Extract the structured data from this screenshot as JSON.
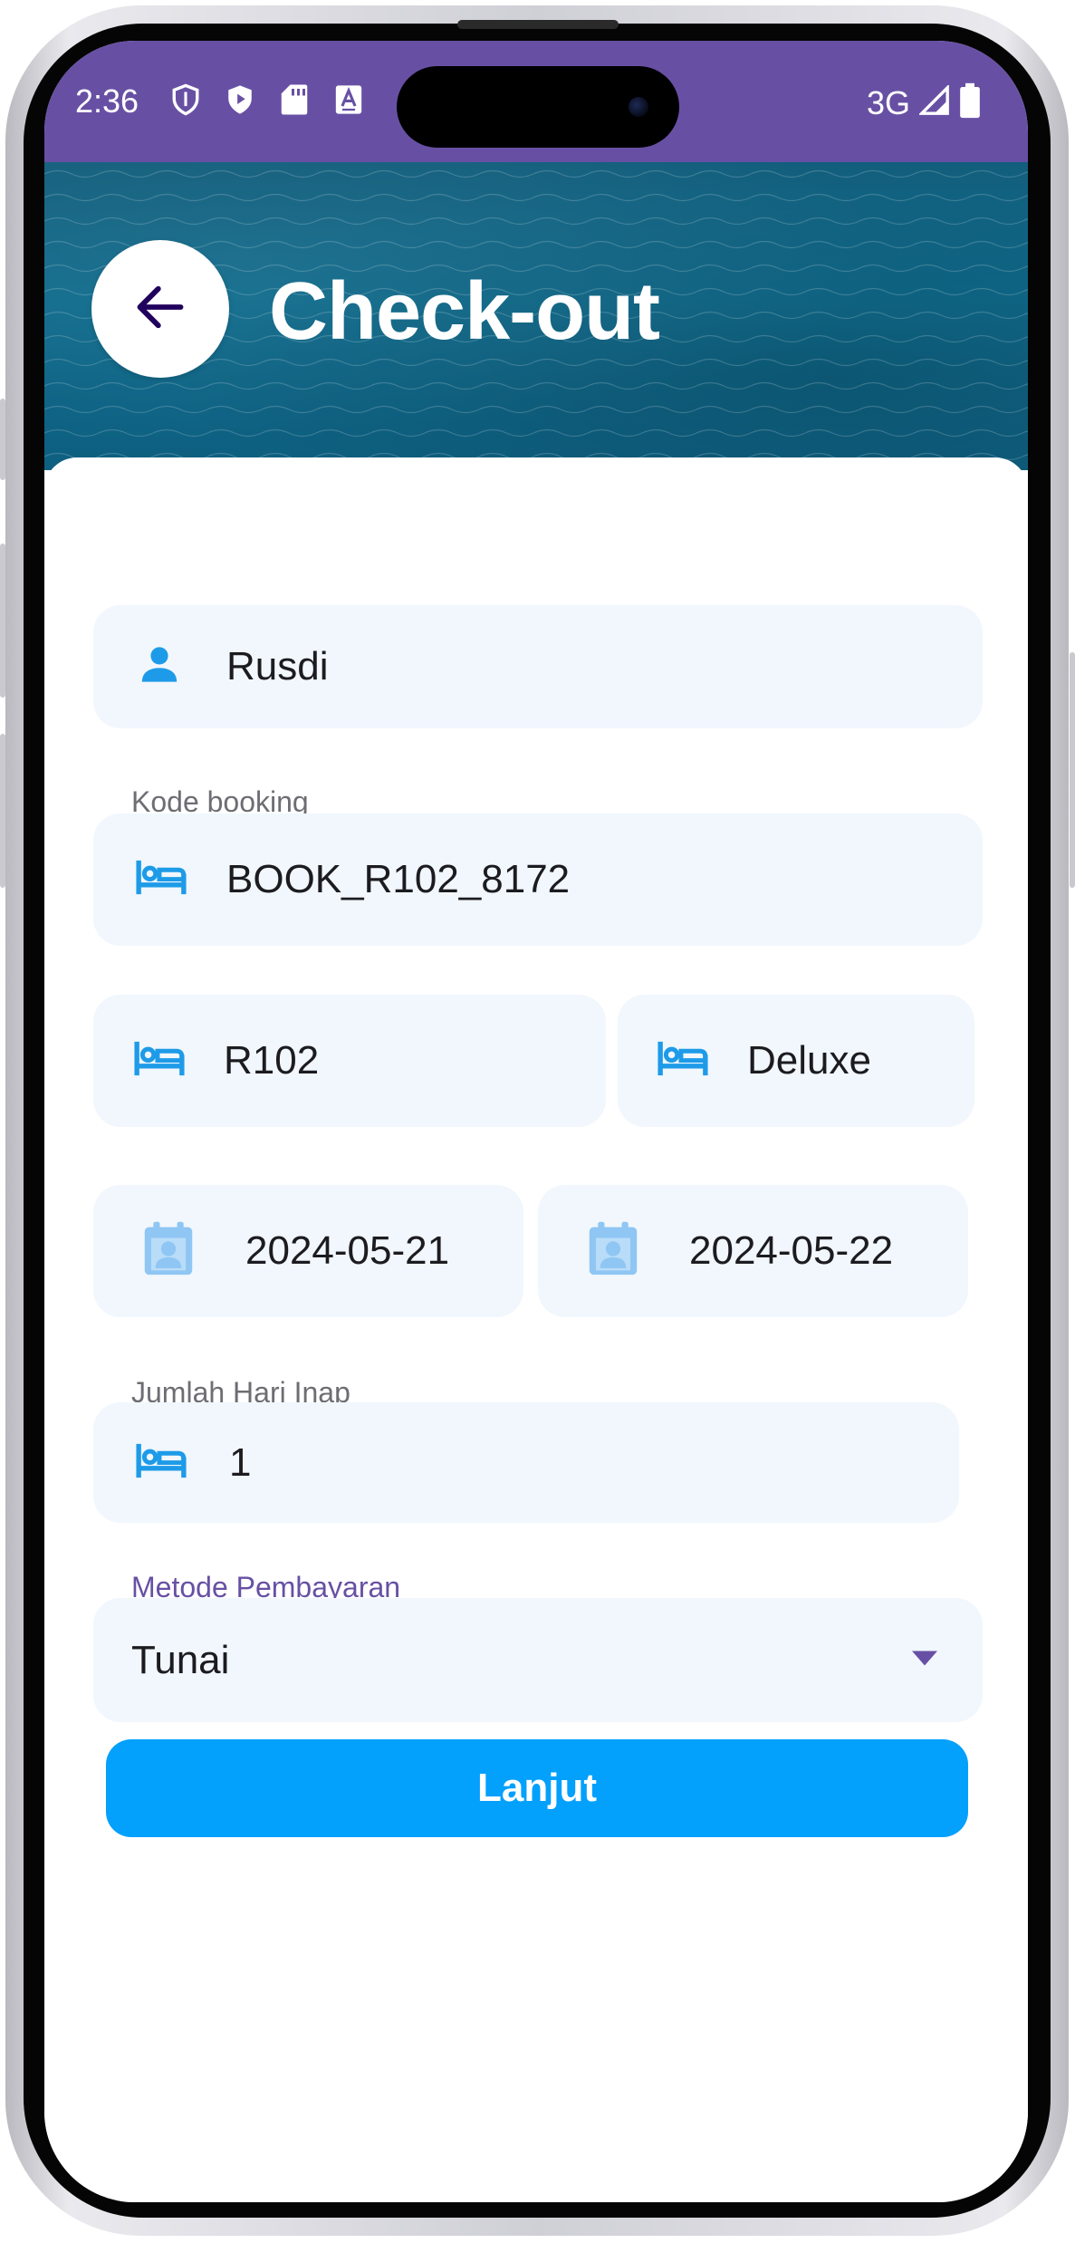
{
  "status_bar": {
    "time": "2:36",
    "network": "3G",
    "icons": [
      "shield-outline-icon",
      "shield-play-icon",
      "sd-card-icon",
      "font-a-icon"
    ],
    "background": "#6750a4"
  },
  "header": {
    "title": "Check-out",
    "back_icon": "arrow-left-icon"
  },
  "form": {
    "guest_name": {
      "value": "Rusdi",
      "icon": "person-icon"
    },
    "booking_code": {
      "label": "Kode booking",
      "value": "BOOK_R102_8172",
      "icon": "bed-icon"
    },
    "room_number": {
      "value": "R102",
      "icon": "bed-icon"
    },
    "room_type": {
      "value": "Deluxe",
      "icon": "bed-icon"
    },
    "check_in_date": {
      "value": "2024-05-21",
      "icon": "calendar-person-icon"
    },
    "check_out_date": {
      "value": "2024-05-22",
      "icon": "calendar-person-icon"
    },
    "nights": {
      "label": "Jumlah Hari Inap",
      "value": "1",
      "icon": "bed-icon"
    },
    "payment_method": {
      "label": "Metode Pembayaran",
      "value": "Tunai"
    }
  },
  "actions": {
    "submit_label": "Lanjut"
  },
  "colors": {
    "accent_blue": "#03a0fc",
    "primary_purple": "#6750a4",
    "field_background": "#f1f7fd"
  }
}
